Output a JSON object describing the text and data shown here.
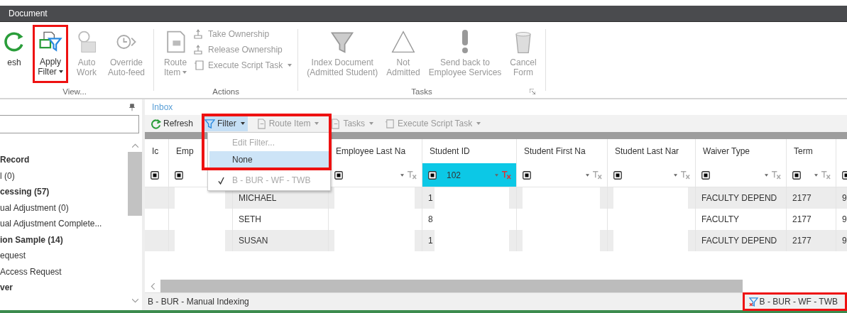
{
  "window": {
    "title": "Document"
  },
  "ribbon": {
    "groups": [
      {
        "label": "View...",
        "buttons": [
          {
            "kind": "refresh",
            "lines": [
              "esh"
            ],
            "disabled": false,
            "dropdown": false,
            "outlined": false
          },
          {
            "kind": "apply-filter",
            "lines": [
              "Apply",
              "Filter"
            ],
            "disabled": false,
            "dropdown": true,
            "outlined": true
          },
          {
            "kind": "auto-work",
            "lines": [
              "Auto",
              "Work"
            ],
            "disabled": true,
            "dropdown": false,
            "outlined": false
          },
          {
            "kind": "override",
            "lines": [
              "Override",
              "Auto-feed"
            ],
            "disabled": true,
            "dropdown": false,
            "outlined": false
          }
        ]
      },
      {
        "label": "Actions",
        "buttons": [
          {
            "kind": "route",
            "lines": [
              "Route",
              "Item"
            ],
            "disabled": true,
            "dropdown": true,
            "outlined": false
          }
        ],
        "small_buttons": [
          {
            "kind": "take",
            "label": "Take Ownership",
            "disabled": true,
            "dropdown": false
          },
          {
            "kind": "release",
            "label": "Release Ownership",
            "disabled": true,
            "dropdown": false
          },
          {
            "kind": "script",
            "label": "Execute Script Task",
            "disabled": true,
            "dropdown": true
          }
        ]
      },
      {
        "label": "Tasks",
        "launcher": true,
        "buttons": [
          {
            "kind": "index",
            "lines": [
              "Index Document",
              "(Admitted Student)"
            ],
            "disabled": true,
            "dropdown": false,
            "outlined": false
          },
          {
            "kind": "not-admitted",
            "lines": [
              "Not",
              "Admitted"
            ],
            "disabled": true,
            "dropdown": false,
            "outlined": false
          },
          {
            "kind": "send-back",
            "lines": [
              "Send back to",
              "Employee Services"
            ],
            "disabled": true,
            "dropdown": false,
            "outlined": false
          },
          {
            "kind": "cancel",
            "lines": [
              "Cancel",
              "Form"
            ],
            "disabled": true,
            "dropdown": false,
            "outlined": false
          }
        ]
      }
    ]
  },
  "sidebar": {
    "items": [
      {
        "label": "Record",
        "bold": true
      },
      {
        "label": "l (0)",
        "bold": false
      },
      {
        "label": "cessing (57)",
        "bold": true
      },
      {
        "label": "ual Adjustment (0)",
        "bold": false
      },
      {
        "label": "ual Adjustment Complete...",
        "bold": false
      },
      {
        "label": "ion Sample (14)",
        "bold": true
      },
      {
        "label": "equest",
        "bold": false
      },
      {
        "label": "Access Request",
        "bold": false
      },
      {
        "label": "ver",
        "bold": true
      }
    ]
  },
  "breadcrumb": "Inbox",
  "toolbar": [
    {
      "kind": "refresh",
      "label": "Refresh",
      "disabled": false,
      "dropdown": false,
      "pressed": false
    },
    {
      "kind": "filter",
      "label": "Filter",
      "disabled": false,
      "dropdown": true,
      "pressed": true
    },
    {
      "kind": "route",
      "label": "Route Item",
      "disabled": true,
      "dropdown": true,
      "pressed": false
    },
    {
      "kind": "tasks",
      "label": "Tasks",
      "disabled": true,
      "dropdown": true,
      "pressed": false
    },
    {
      "kind": "script",
      "label": "Execute Script Task",
      "disabled": true,
      "dropdown": true,
      "pressed": false
    }
  ],
  "filter_menu": {
    "outlined": true,
    "items": [
      {
        "label": "Edit Filter...",
        "disabled": true,
        "selected": false,
        "checked": false
      },
      {
        "label": "None",
        "disabled": false,
        "selected": true,
        "checked": false
      },
      {
        "label": "B - BUR - WF - TWB",
        "disabled": true,
        "selected": false,
        "checked": true
      }
    ]
  },
  "table": {
    "columns": [
      {
        "header": "Ic",
        "filter": {
          "active": false
        }
      },
      {
        "header": "Emp",
        "filter": {
          "active": false
        }
      },
      {},
      {
        "header": "Employee Last Na",
        "filter": {
          "clearable": true,
          "active": false
        }
      },
      {
        "header": "Student ID",
        "filter": {
          "clearable": true,
          "active": true,
          "value": "102"
        }
      },
      {
        "header": "Student First Na",
        "filter": {
          "clearable": true,
          "active": false
        }
      },
      {
        "header": "Student Last Nar",
        "filter": {
          "clearable": true,
          "active": false
        }
      },
      {
        "header": "Waiver Type",
        "filter": {
          "clearable": true,
          "active": false
        }
      },
      {
        "header": "Term",
        "filter": {
          "clearable": true,
          "active": false
        }
      },
      {
        "filter": {
          "active": false
        }
      }
    ],
    "rows": [
      {
        "shaded": true,
        "cells": [
          {},
          {
            "redacted": true
          },
          {
            "text": "MICHAEL"
          },
          {
            "redacted": true
          },
          {
            "text": "1",
            "redacted": true
          },
          {
            "redacted": true
          },
          {
            "redacted": true
          },
          {
            "text": "FACULTY DEPEND"
          },
          {
            "text": "2177"
          },
          {
            "text": "9"
          }
        ]
      },
      {
        "shaded": false,
        "cells": [
          {},
          {},
          {
            "text": "SETH"
          },
          {},
          {
            "text": "8"
          },
          {},
          {},
          {
            "text": "FACULTY"
          },
          {
            "text": "2177"
          },
          {
            "text": "9"
          }
        ]
      },
      {
        "shaded": true,
        "cells": [
          {},
          {
            "redacted": true
          },
          {
            "text": "SUSAN"
          },
          {
            "redacted": true
          },
          {
            "text": "1",
            "redacted": true
          },
          {
            "redacted": true
          },
          {
            "redacted": true
          },
          {
            "text": "FACULTY DEPEND"
          },
          {
            "text": "2177"
          },
          {
            "text": "9"
          }
        ]
      }
    ]
  },
  "status_bar": {
    "left": "B - BUR - Manual Indexing",
    "right": "B - BUR - WF - TWB",
    "right_outlined": true
  }
}
